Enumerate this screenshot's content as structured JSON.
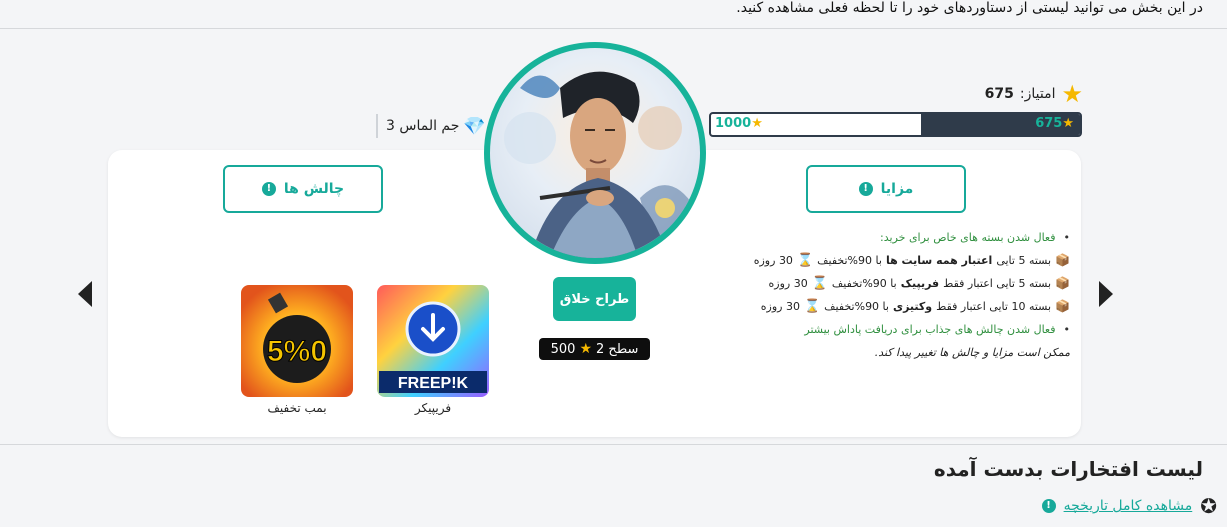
{
  "intro_text": "در این بخش می توانید لیستی از دستاوردهای خود را تا لحظه فعلی مشاهده کنید.",
  "score": {
    "label": "امتیاز:",
    "value": "675"
  },
  "progress": {
    "current": "675",
    "max": "1000",
    "fraction": 0.43
  },
  "gems": {
    "label": "جم الماس 3"
  },
  "buttons": {
    "benefits": "مزایا",
    "challenges": "چالش ها",
    "role": "طراح خلاق"
  },
  "level": {
    "label": "سطح 2",
    "points": "500"
  },
  "perks": {
    "intro": "فعال شدن بسته های خاص برای خرید:",
    "items": [
      {
        "prefix": "بسته 5 تایی",
        "bold": "اعتبار همه سایت ها",
        "suffix": "با 90%تخفیف",
        "days": "30 روزه"
      },
      {
        "prefix": "بسته 5 تایی اعتبار فقط",
        "bold": "فریپیک",
        "suffix": "با 90%تخفیف",
        "days": "30 روزه"
      },
      {
        "prefix": "بسته 10 تایی اعتبار فقط",
        "bold": "وکتیزی",
        "suffix": "با 90%تخفیف",
        "days": "30 روزه"
      }
    ],
    "challenge_note": "فعال شدن چالش های جذاب برای دریافت پاداش بیشتر",
    "disclaimer": "ممکن است مزایا و چالش ها تغییر پیدا کند."
  },
  "games": [
    {
      "label": "فریپیکر",
      "logo_text": "FREEP!K"
    },
    {
      "label": "بمب تخفیف",
      "logo_text": "5%0"
    }
  ],
  "section_title": "لیست افتخارات بدست آمده",
  "history_link": "مشاهده کامل تاریخچه",
  "colors": {
    "accent": "#17b39a",
    "dark": "#2f3b4a",
    "star": "#f5b800"
  }
}
